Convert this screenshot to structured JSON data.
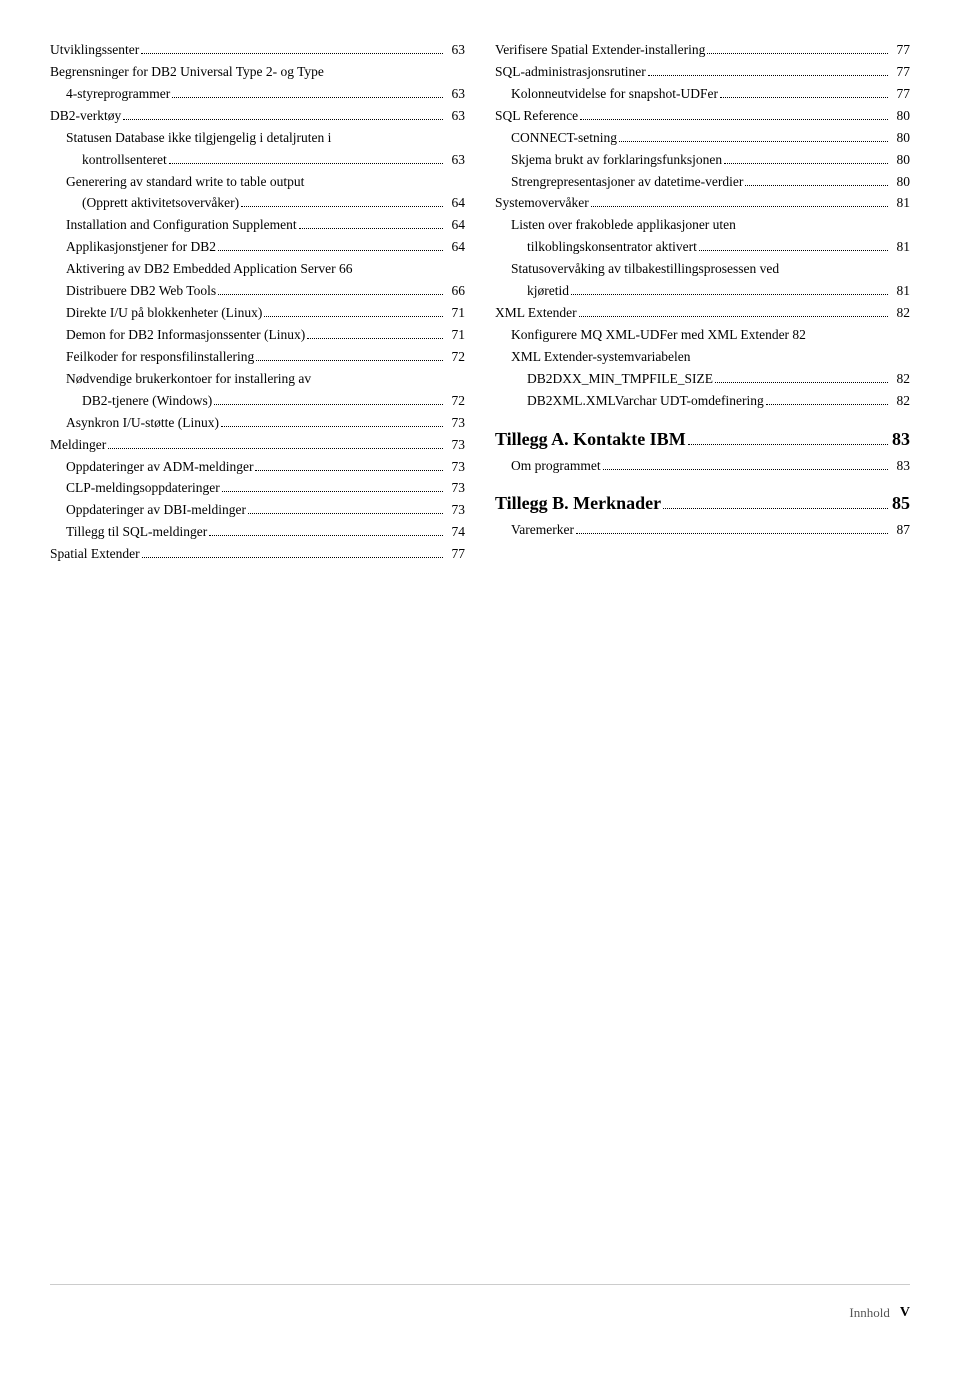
{
  "footer": {
    "label": "Innhold",
    "page": "V"
  },
  "left_col": [
    {
      "text": "Utviklingssenter",
      "dots": true,
      "page": "63",
      "indent": 0
    },
    {
      "text": "Begrensninger for DB2 Universal Type 2- og Type",
      "dots": false,
      "page": "",
      "indent": 0
    },
    {
      "text": "4-styreprogrammer",
      "dots": true,
      "page": "63",
      "indent": 1
    },
    {
      "text": "DB2-verktøy",
      "dots": true,
      "page": "63",
      "indent": 0
    },
    {
      "text": "Statusen Database ikke tilgjengelig i detaljruten i",
      "dots": false,
      "page": "",
      "indent": 1
    },
    {
      "text": "kontrollsenteret",
      "dots": true,
      "page": "63",
      "indent": 2
    },
    {
      "text": "Generering av standard write to table output",
      "dots": false,
      "page": "",
      "indent": 1
    },
    {
      "text": "(Opprett aktivitetsovervåker)",
      "dots": true,
      "page": "64",
      "indent": 2
    },
    {
      "text": "Installation and Configuration Supplement",
      "dots": true,
      "page": "64",
      "indent": 1
    },
    {
      "text": "Applikasjonstjener for DB2",
      "dots": true,
      "page": "64",
      "indent": 1
    },
    {
      "text": "Aktivering av DB2 Embedded Application Server",
      "dots": false,
      "page": "66",
      "indent": 1,
      "notrail": true
    },
    {
      "text": "Distribuere DB2 Web Tools",
      "dots": true,
      "page": "66",
      "indent": 1
    },
    {
      "text": "Direkte I/U på blokkenheter (Linux)",
      "dots": true,
      "page": "71",
      "indent": 1
    },
    {
      "text": "Demon for DB2 Informasjonssenter (Linux)",
      "dots": true,
      "page": "71",
      "indent": 1
    },
    {
      "text": "Feilkoder for responsfilinstallering",
      "dots": true,
      "page": "72",
      "indent": 1
    },
    {
      "text": "Nødvendige brukerkontoer for installering av",
      "dots": false,
      "page": "",
      "indent": 1
    },
    {
      "text": "DB2-tjenere (Windows)",
      "dots": true,
      "page": "72",
      "indent": 2
    },
    {
      "text": "Asynkron I/U-støtte (Linux)",
      "dots": true,
      "page": "73",
      "indent": 1
    },
    {
      "text": "Meldinger",
      "dots": true,
      "page": "73",
      "indent": 0
    },
    {
      "text": "Oppdateringer av ADM-meldinger",
      "dots": true,
      "page": "73",
      "indent": 1
    },
    {
      "text": "CLP-meldingsoppdateringer",
      "dots": true,
      "page": "73",
      "indent": 1
    },
    {
      "text": "Oppdateringer av DBI-meldinger",
      "dots": true,
      "page": "73",
      "indent": 1
    },
    {
      "text": "Tillegg til SQL-meldinger",
      "dots": true,
      "page": "74",
      "indent": 1
    },
    {
      "text": "Spatial Extender",
      "dots": true,
      "page": "77",
      "indent": 0
    }
  ],
  "right_col": [
    {
      "text": "Verifisere Spatial Extender-installering",
      "dots": true,
      "page": "77",
      "indent": 0
    },
    {
      "text": "SQL-administrasjonsrutiner",
      "dots": true,
      "page": "77",
      "indent": 0
    },
    {
      "text": "Kolonneutvidelse for snapshot-UDFer",
      "dots": true,
      "page": "77",
      "indent": 1
    },
    {
      "text": "SQL Reference",
      "dots": true,
      "page": "80",
      "indent": 0
    },
    {
      "text": "CONNECT-setning",
      "dots": true,
      "page": "80",
      "indent": 1
    },
    {
      "text": "Skjema brukt av forklaringsfunksjonen",
      "dots": true,
      "page": "80",
      "indent": 1
    },
    {
      "text": "Strengrepresentasjoner av datetime-verdier",
      "dots": true,
      "page": "80",
      "indent": 1
    },
    {
      "text": "Systemovervåker",
      "dots": true,
      "page": "81",
      "indent": 0
    },
    {
      "text": "Listen over frakoblede applikasjoner uten",
      "dots": false,
      "page": "",
      "indent": 1
    },
    {
      "text": "tilkoblingskonsentrator aktivert",
      "dots": true,
      "page": "81",
      "indent": 2
    },
    {
      "text": "Statusovervåking av tilbakestillingsprosessen ved",
      "dots": false,
      "page": "",
      "indent": 1
    },
    {
      "text": "kjøretid",
      "dots": true,
      "page": "81",
      "indent": 2
    },
    {
      "text": "XML Extender",
      "dots": true,
      "page": "82",
      "indent": 0
    },
    {
      "text": "Konfigurere MQ XML-UDFer med XML Extender",
      "dots": false,
      "page": "82",
      "indent": 1,
      "notrail": true
    },
    {
      "text": "XML Extender-systemvariabelen",
      "dots": false,
      "page": "",
      "indent": 1
    },
    {
      "text": "DB2DXX_MIN_TMPFILE_SIZE",
      "dots": true,
      "page": "82",
      "indent": 2
    },
    {
      "text": "DB2XML.XMLVarchar UDT-omdefinering",
      "dots": true,
      "page": "82",
      "indent": 2
    },
    {
      "text": "Tillegg A. Kontakte IBM",
      "dots": true,
      "page": "83",
      "heading": true
    },
    {
      "text": "Om programmet",
      "dots": true,
      "page": "83",
      "indent": 1
    },
    {
      "text": "Tillegg B. Merknader",
      "dots": true,
      "page": "85",
      "heading": true
    },
    {
      "text": "Varemerker",
      "dots": true,
      "page": "87",
      "indent": 1
    }
  ]
}
